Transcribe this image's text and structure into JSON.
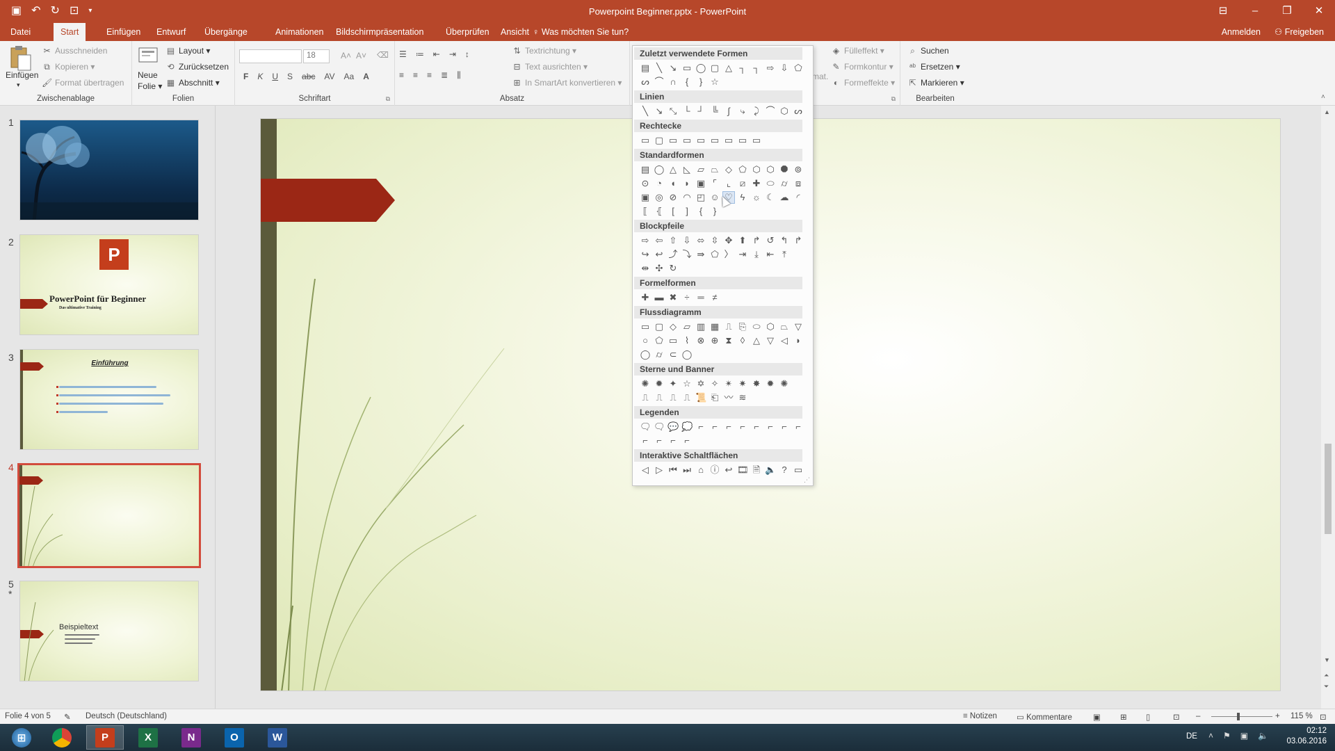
{
  "window": {
    "title": "Powerpoint Beginner.pptx - PowerPoint"
  },
  "tabs": [
    {
      "label": "Datei"
    },
    {
      "label": "Start"
    },
    {
      "label": "Einfügen"
    },
    {
      "label": "Entwurf"
    },
    {
      "label": "Übergänge"
    },
    {
      "label": "Animationen"
    },
    {
      "label": "Bildschirmpräsentation"
    },
    {
      "label": "Überprüfen"
    },
    {
      "label": "Ansicht"
    }
  ],
  "tell_me": "Was möchten Sie tun?",
  "account": {
    "signin": "Anmelden",
    "share": "Freigeben"
  },
  "ribbon": {
    "clipboard": {
      "paste": "Einfügen",
      "cut": "Ausschneiden",
      "copy": "Kopieren",
      "format_painter": "Format übertragen",
      "label": "Zwischenablage"
    },
    "slides": {
      "new_slide_1": "Neue",
      "new_slide_2": "Folie",
      "layout": "Layout",
      "reset": "Zurücksetzen",
      "section": "Abschnitt",
      "label": "Folien"
    },
    "font": {
      "size": "18",
      "bold": "F",
      "italic": "K",
      "underline": "U",
      "shadow": "S",
      "strike": "abc",
      "spacing": "AV",
      "case": "Aa",
      "color": "A",
      "label": "Schriftart"
    },
    "paragraph": {
      "text_direction": "Textrichtung",
      "align_text": "Text ausrichten",
      "smartart": "In SmartArt konvertieren",
      "label": "Absatz"
    },
    "drawing": {
      "fill": "Fülleffekt",
      "outline": "Formkontur",
      "effects": "Formeffekte",
      "partial": "mat."
    },
    "editing": {
      "find": "Suchen",
      "replace": "Ersetzen",
      "select": "Markieren",
      "label": "Bearbeiten"
    }
  },
  "thumbnails": [
    {
      "num": "1"
    },
    {
      "num": "2",
      "title": "PowerPoint für Beginner",
      "subtitle": "Das ultimative Training"
    },
    {
      "num": "3",
      "title": "Einführung"
    },
    {
      "num": "4"
    },
    {
      "num": "5",
      "marker": "*",
      "title": "Beispieltext"
    }
  ],
  "shapes_menu": {
    "categories": [
      "Zuletzt verwendete Formen",
      "Linien",
      "Rechtecke",
      "Standardformen",
      "Blockpfeile",
      "Formelformen",
      "Flussdiagramm",
      "Sterne und Banner",
      "Legenden",
      "Interaktive Schaltflächen"
    ]
  },
  "status": {
    "slide": "Folie 4 von 5",
    "language": "Deutsch (Deutschland)",
    "notes": "Notizen",
    "comments": "Kommentare",
    "zoom": "115 %"
  },
  "taskbar": {
    "lang": "DE",
    "time": "02:12",
    "date": "03.06.2016"
  },
  "colors": {
    "accent": "#b7472a",
    "banner": "#9b2715",
    "slide_bar": "#5b5a3b"
  }
}
